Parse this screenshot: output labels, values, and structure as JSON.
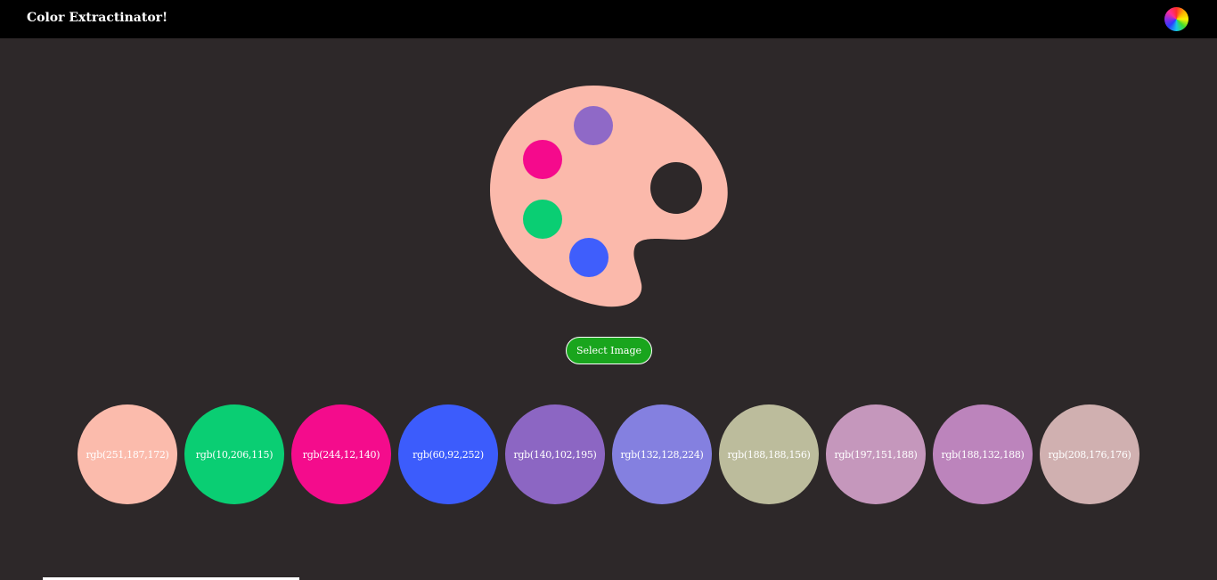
{
  "header": {
    "title": "Color Extractinator!",
    "wheel_icon": "color-wheel-icon"
  },
  "image": {
    "palette_color": "#fbb9ab",
    "hole_color": "#2d2829",
    "dots": [
      {
        "color": "#8f69c7"
      },
      {
        "color": "#f50a8c"
      },
      {
        "color": "#0ace73"
      },
      {
        "color": "#3f5efc"
      }
    ]
  },
  "select_button": {
    "label": "Select Image",
    "color": "#19a51d"
  },
  "swatches": [
    {
      "label": "rgb(251,187,172)",
      "color": "#fbbbac"
    },
    {
      "label": "rgb(10,206,115)",
      "color": "#0ace73"
    },
    {
      "label": "rgb(244,12,140)",
      "color": "#f40c8c"
    },
    {
      "label": "rgb(60,92,252)",
      "color": "#3c5cfc"
    },
    {
      "label": "rgb(140,102,195)",
      "color": "#8c66c3"
    },
    {
      "label": "rgb(132,128,224)",
      "color": "#8480e0"
    },
    {
      "label": "rgb(188,188,156)",
      "color": "#bcbc9c"
    },
    {
      "label": "rgb(197,151,188)",
      "color": "#c597bc"
    },
    {
      "label": "rgb(188,132,188)",
      "color": "#bc84bc"
    },
    {
      "label": "rgb(208,176,176)",
      "color": "#d0b0b0"
    }
  ]
}
